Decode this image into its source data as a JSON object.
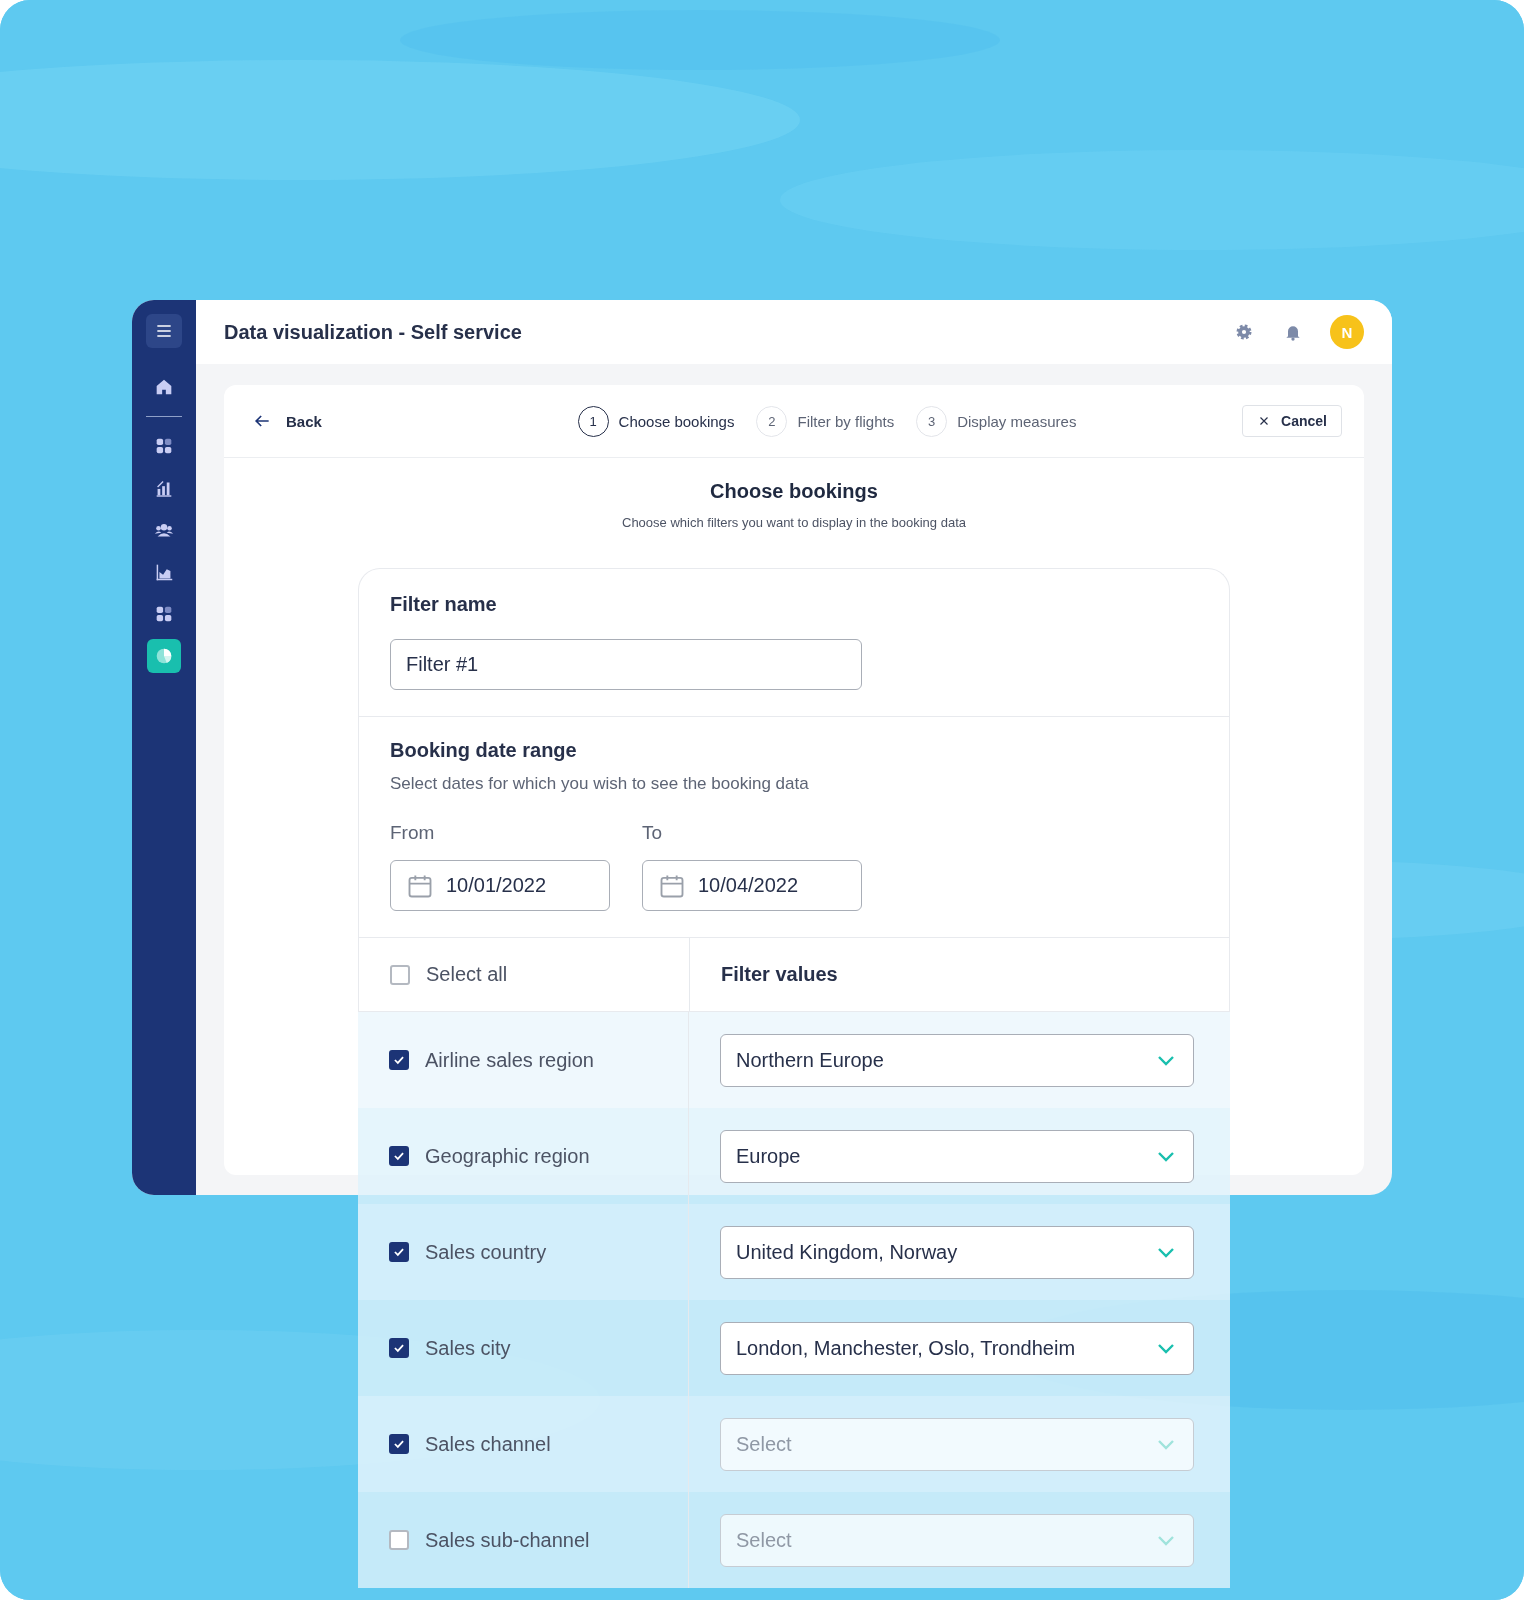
{
  "sidebar": {
    "items": [
      {
        "kind": "home",
        "selected": false
      },
      {
        "kind": "grid",
        "selected": false
      },
      {
        "kind": "bars",
        "selected": false
      },
      {
        "kind": "people",
        "selected": false
      },
      {
        "kind": "area",
        "selected": false
      },
      {
        "kind": "grid",
        "selected": false
      },
      {
        "kind": "pie",
        "selected": true
      }
    ]
  },
  "header": {
    "title": "Data visualization - Self service",
    "avatar": "N"
  },
  "wizard": {
    "back": "Back",
    "cancel": "Cancel",
    "steps": [
      {
        "number": "1",
        "label": "Choose bookings",
        "selected": true
      },
      {
        "number": "2",
        "label": "Filter by flights",
        "selected": false
      },
      {
        "number": "3",
        "label": "Display measures",
        "selected": false
      }
    ],
    "heading": "Choose bookings",
    "subheading": "Choose which filters you want to display in the booking data"
  },
  "filter_name": {
    "label": "Filter name",
    "value": "Filter #1"
  },
  "date_range": {
    "title": "Booking date range",
    "description": "Select dates for which you wish to see the booking data",
    "from_label": "From",
    "from": "10/01/2022",
    "to_label": "To",
    "to": "10/04/2022"
  },
  "table": {
    "select_all": {
      "label": "Select all",
      "checked": false
    },
    "values_heading": "Filter values",
    "rows": [
      {
        "label": "Airline sales region",
        "checked": true,
        "value": "Northern Europe"
      },
      {
        "label": "Geographic region",
        "checked": true,
        "value": "Europe"
      },
      {
        "label": "Sales country",
        "checked": true,
        "value": "United Kingdom, Norway"
      },
      {
        "label": "Sales city",
        "checked": true,
        "value": "London, Manchester, Oslo, Trondheim"
      },
      {
        "label": "Sales channel",
        "checked": true,
        "placeholder": "Select"
      },
      {
        "label": "Sales sub-channel",
        "checked": false,
        "placeholder": "Select"
      }
    ]
  }
}
